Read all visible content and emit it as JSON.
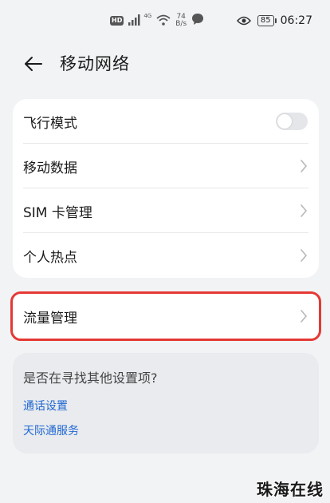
{
  "status_bar": {
    "hd_badge": "HD",
    "network_gen": "4G",
    "speed_value": "74",
    "speed_unit": "B/s",
    "battery": "85",
    "time": "06:27"
  },
  "header": {
    "title": "移动网络"
  },
  "main_card": {
    "rows": [
      {
        "label": "飞行模式",
        "control": "toggle",
        "toggle_on": false
      },
      {
        "label": "移动数据",
        "control": "chevron"
      },
      {
        "label": "SIM 卡管理",
        "control": "chevron"
      },
      {
        "label": "个人热点",
        "control": "chevron"
      }
    ]
  },
  "traffic_card": {
    "label": "流量管理",
    "highlight_color": "#e53935"
  },
  "suggest_card": {
    "title": "是否在寻找其他设置项?",
    "links": [
      "通话设置",
      "天际通服务"
    ]
  },
  "watermark": "珠海在线",
  "colors": {
    "background": "#f1f3f5",
    "link": "#1f67d2",
    "card": "#ffffff"
  }
}
